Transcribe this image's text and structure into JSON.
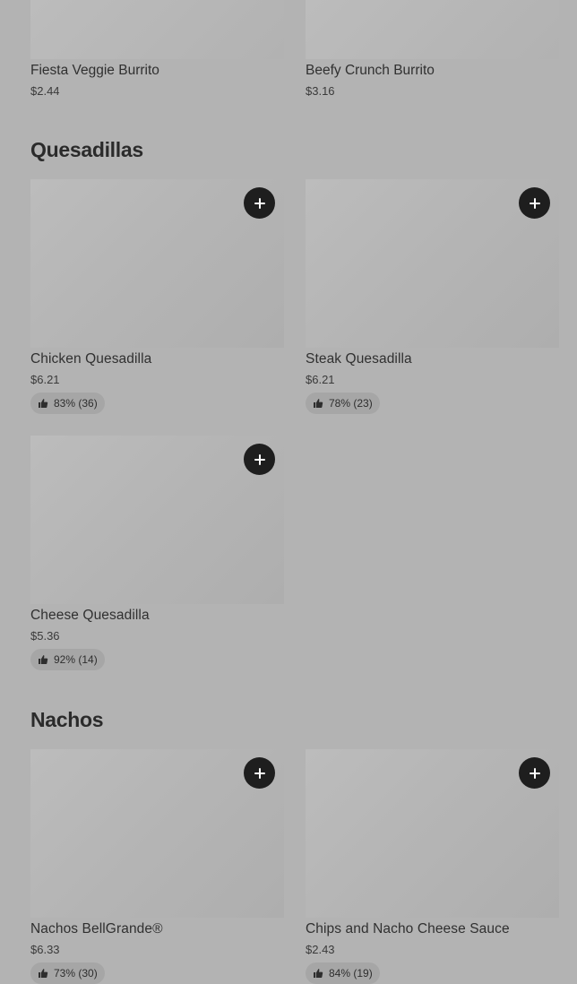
{
  "top_items": [
    {
      "name": "Fiesta Veggie Burrito",
      "price": "$2.44"
    },
    {
      "name": "Beefy Crunch Burrito",
      "price": "$3.16"
    }
  ],
  "sections": {
    "quesadillas": {
      "title": "Quesadillas",
      "items": [
        {
          "name": "Chicken Quesadilla",
          "price": "$6.21",
          "rating": "83% (36)"
        },
        {
          "name": "Steak Quesadilla",
          "price": "$6.21",
          "rating": "78% (23)"
        },
        {
          "name": "Cheese Quesadilla",
          "price": "$5.36",
          "rating": "92% (14)"
        }
      ]
    },
    "nachos": {
      "title": "Nachos",
      "items": [
        {
          "name": "Nachos BellGrande®",
          "price": "$6.33",
          "rating": "73% (30)"
        },
        {
          "name": "Chips and Nacho Cheese Sauce",
          "price": "$2.43",
          "rating": "84% (19)"
        }
      ]
    }
  },
  "icons": {
    "add": "plus-icon",
    "rating": "thumbs-up-icon"
  },
  "colors": {
    "background": "#b3b3b3",
    "add_button": "#1e1e1e",
    "rating_pill": "#a6a6a6"
  }
}
